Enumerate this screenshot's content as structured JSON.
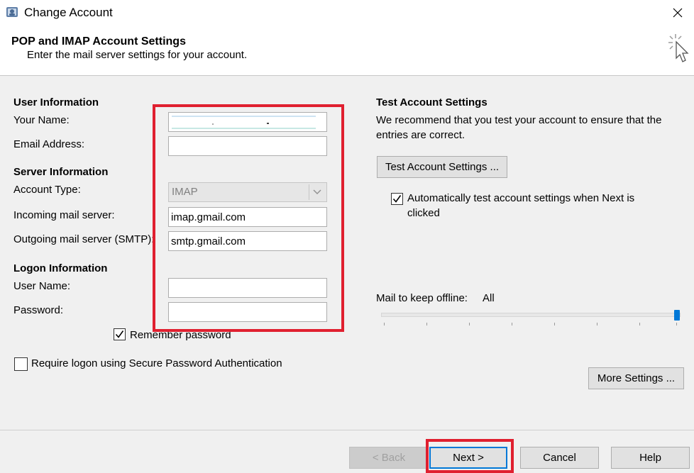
{
  "window": {
    "title": "Change Account",
    "close_symbol": "✕"
  },
  "header": {
    "title": "POP and IMAP Account Settings",
    "subtitle": "Enter the mail server settings for your account."
  },
  "user_info": {
    "section_label": "User Information",
    "your_name_label": "Your Name:",
    "your_name_value": "",
    "email_label": "Email Address:",
    "email_value": ""
  },
  "server_info": {
    "section_label": "Server Information",
    "account_type_label": "Account Type:",
    "account_type_value": "IMAP",
    "incoming_label": "Incoming mail server:",
    "incoming_value": "imap.gmail.com",
    "outgoing_label": "Outgoing mail server (SMTP):",
    "outgoing_value": "smtp.gmail.com"
  },
  "logon_info": {
    "section_label": "Logon Information",
    "username_label": "User Name:",
    "username_value": "",
    "password_label": "Password:",
    "password_value": "",
    "remember_label": "Remember password",
    "remember_checked": true,
    "spa_label": "Require logon using Secure Password Authentication",
    "spa_checked": false
  },
  "test_settings": {
    "section_label": "Test Account Settings",
    "description": "We recommend that you test your account to ensure that the entries are correct.",
    "description_line1": "We recommend that you test your account to ensure that the",
    "description_line2": "entries are correct.",
    "test_button_label": "Test Account Settings ...",
    "auto_test_label_line1": "Automatically test account settings when Next is",
    "auto_test_label_line2": "clicked",
    "auto_test_checked": true
  },
  "offline": {
    "label": "Mail to keep offline:",
    "value": "All",
    "slider_fraction": 1.0
  },
  "more_settings_label": "More Settings ...",
  "footer": {
    "back_label": "< Back",
    "next_label": "Next >",
    "cancel_label": "Cancel",
    "help_label": "Help"
  },
  "colors": {
    "highlight": "#e02030",
    "accent": "#0078d7"
  }
}
